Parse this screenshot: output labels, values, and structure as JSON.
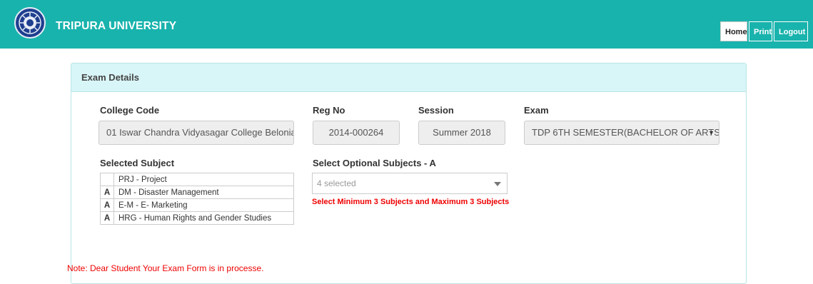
{
  "header": {
    "title": "TRIPURA UNIVERSITY",
    "nav": {
      "home": "Home",
      "print": "Print",
      "logout": "Logout"
    },
    "colors": {
      "bar": "#19b3ad"
    }
  },
  "panel": {
    "heading": "Exam Details",
    "college_code": {
      "label": "College Code",
      "value": "01 Iswar Chandra Vidyasagar College  Belonia"
    },
    "reg_no": {
      "label": "Reg No",
      "value": "2014-000264"
    },
    "session": {
      "label": "Session",
      "value": "Summer  2018"
    },
    "exam": {
      "label": "Exam",
      "value": "TDP 6TH SEMESTER(BACHELOR OF ARTS"
    },
    "selected_subject": {
      "label": "Selected Subject",
      "rows": [
        {
          "group": "",
          "name": "PRJ - Project"
        },
        {
          "group": "A",
          "name": "DM - Disaster Management"
        },
        {
          "group": "A",
          "name": "E-M - E- Marketing"
        },
        {
          "group": "A",
          "name": "HRG - Human Rights and Gender Studies"
        }
      ]
    },
    "optional_subjects": {
      "label": "Select Optional Subjects - A",
      "value": "4 selected",
      "warning": "Select Minimum 3 Subjects and Maximum 3 Subjects"
    }
  },
  "note": "Note: Dear Student Your Exam Form is in processe."
}
